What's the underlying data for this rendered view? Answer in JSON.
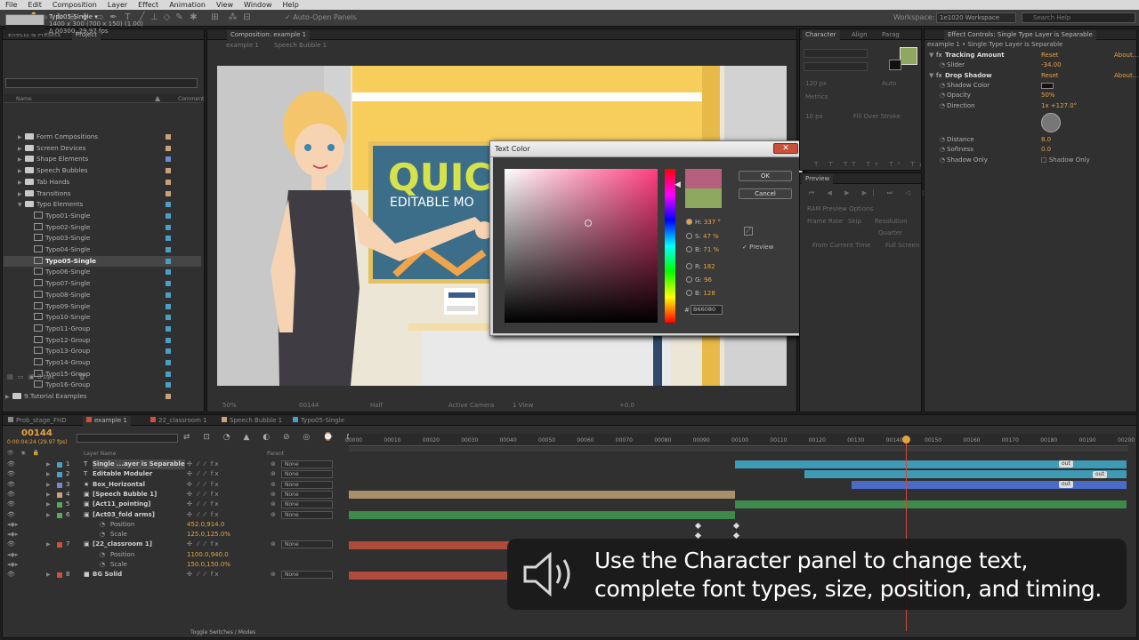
{
  "menu": [
    "File",
    "Edit",
    "Composition",
    "Layer",
    "Effect",
    "Animation",
    "View",
    "Window",
    "Help"
  ],
  "toolbar": {
    "auto_open": "Auto-Open Panels",
    "workspace_label": "Workspace:",
    "workspace_value": "1e1020 Workspace",
    "search_placeholder": "Search Help"
  },
  "project": {
    "tabs": [
      "Effects & Presets",
      "Project"
    ],
    "comp_name": "Typo05-Single ▾",
    "comp_size": "1400 x 300  (700 x 150) (1.00)",
    "comp_dur": "Δ 00300, 29.97 fps",
    "col_name": "Name",
    "col_comment": "Comment",
    "bpc": "8 bpc",
    "items": [
      {
        "label": "Form Compositions",
        "type": "folder",
        "color": "#c8a27a"
      },
      {
        "label": "Screen Devices",
        "type": "folder",
        "color": "#c8a27a"
      },
      {
        "label": "Shape Elements",
        "type": "folder",
        "color": "#6f8bd1"
      },
      {
        "label": "Speech Bubbles",
        "type": "folder",
        "color": "#c8a27a"
      },
      {
        "label": "Tab Hands",
        "type": "folder",
        "color": "#c8a27a"
      },
      {
        "label": "Transitions",
        "type": "folder",
        "color": "#c8a27a"
      },
      {
        "label": "Typo Elements",
        "type": "folder-open",
        "color": "#4aa0c4"
      },
      {
        "label": "Typo01-Single",
        "type": "comp",
        "color": "#4aa0c4"
      },
      {
        "label": "Typo02-Single",
        "type": "comp",
        "color": "#4aa0c4"
      },
      {
        "label": "Typo03-Single",
        "type": "comp",
        "color": "#4aa0c4"
      },
      {
        "label": "Typo04-Single",
        "type": "comp",
        "color": "#4aa0c4"
      },
      {
        "label": "Typo05-Single",
        "type": "comp",
        "color": "#4aa0c4",
        "selected": true
      },
      {
        "label": "Typo06-Single",
        "type": "comp",
        "color": "#4aa0c4"
      },
      {
        "label": "Typo07-Single",
        "type": "comp",
        "color": "#4aa0c4"
      },
      {
        "label": "Typo08-Single",
        "type": "comp",
        "color": "#4aa0c4"
      },
      {
        "label": "Typo09-Single",
        "type": "comp",
        "color": "#4aa0c4"
      },
      {
        "label": "Typo10-Single",
        "type": "comp",
        "color": "#4aa0c4"
      },
      {
        "label": "Typo11-Group",
        "type": "comp",
        "color": "#4aa0c4"
      },
      {
        "label": "Typo12-Group",
        "type": "comp",
        "color": "#4aa0c4"
      },
      {
        "label": "Typo13-Group",
        "type": "comp",
        "color": "#4aa0c4"
      },
      {
        "label": "Typo14-Group",
        "type": "comp",
        "color": "#4aa0c4"
      },
      {
        "label": "Typo15-Group",
        "type": "comp",
        "color": "#4aa0c4"
      },
      {
        "label": "Typo16-Group",
        "type": "comp",
        "color": "#4aa0c4"
      },
      {
        "label": "9.Tutorial Examples",
        "type": "folder",
        "color": "#c8a27a"
      }
    ]
  },
  "composition": {
    "tab": "Composition: example 1",
    "subtabs": [
      "example 1",
      "Speech Bubble 1"
    ],
    "canvas_text1": "QUIC",
    "canvas_text2": "EDITABLE MO",
    "footer": [
      "50%",
      "00144",
      "Half",
      "Active Camera",
      "1 View",
      "+0.0"
    ]
  },
  "dialog": {
    "title": "Text Color",
    "ok": "OK",
    "cancel": "Cancel",
    "new_color": "#b66080",
    "old_color": "#8fa860",
    "h_label": "H:",
    "h_val": "337 °",
    "s_label": "S:",
    "s_val": "47 %",
    "b_label": "B:",
    "b_val": "71 %",
    "r_label": "R:",
    "r_val": "182",
    "g_label": "G:",
    "g_val": "96",
    "bl_label": "B:",
    "bl_val": "128",
    "hex": "B66080",
    "preview": "Preview"
  },
  "character": {
    "tabs": [
      "Character",
      "Align",
      "Parag"
    ],
    "fill_over": "Fill Over Stroke",
    "metrics": "Metrics",
    "size": "120 px",
    "auto": "Auto",
    "stroke": "10 px"
  },
  "preview_panel": {
    "tabs": [
      "Preview"
    ],
    "ram_opt": "RAM Preview Options",
    "frame_rate": "Frame Rate",
    "skip": "Skip",
    "resolution": "Resolution",
    "from_current": "From Current Time",
    "full_screen": "Full Screen",
    "quarter": "Quarter"
  },
  "effects": {
    "tab": "Effect Controls: Single Type Layer is Separable",
    "header": "example 1 • Single Type Layer is Separable",
    "rows": [
      {
        "label": "Tracking Amount",
        "indent": 0,
        "bold": true,
        "fx": true,
        "link": "Reset",
        "link2": "About..."
      },
      {
        "label": "Slider",
        "indent": 1,
        "val": "-34.00"
      },
      {
        "label": "Drop Shadow",
        "indent": 0,
        "bold": true,
        "fx": true,
        "link": "Reset",
        "link2": "About..."
      },
      {
        "label": "Shadow Color",
        "indent": 1,
        "color": "#111111"
      },
      {
        "label": "Opacity",
        "indent": 1,
        "val": "50%"
      },
      {
        "label": "Direction",
        "indent": 1,
        "val": "1x +127.0°"
      },
      {
        "label": "Distance",
        "indent": 1,
        "val": "8.0"
      },
      {
        "label": "Softness",
        "indent": 1,
        "val": "0.0"
      },
      {
        "label": "Shadow Only",
        "indent": 1,
        "check": "Shadow Only"
      }
    ]
  },
  "timeline": {
    "tabs": [
      "Prob_stage_FHD",
      "example 1",
      "22_classroom 1",
      "Speech Bubble 1",
      "Typo05-Single"
    ],
    "time": "00144",
    "fps": "0:00:04:24 (29.97 fps)",
    "col_layer": "Layer Name",
    "col_parent": "Parent",
    "ticks": [
      "00000",
      "00010",
      "00020",
      "00030",
      "00040",
      "00050",
      "00060",
      "00070",
      "00080",
      "00090",
      "00100",
      "00110",
      "00120",
      "00130",
      "00140",
      "00150",
      "00160",
      "00170",
      "00180",
      "00190",
      "00200"
    ],
    "layers": [
      {
        "num": "1",
        "name": "Single ...ayer is Separable",
        "color": "#4aa0c4",
        "parent": "None",
        "kind": "T"
      },
      {
        "num": "2",
        "name": "Editable Moduler",
        "color": "#4aa0c4",
        "parent": "None",
        "kind": "T"
      },
      {
        "num": "3",
        "name": "Box_Horizontal",
        "color": "#6f8bd1",
        "parent": "None",
        "kind": "★"
      },
      {
        "num": "4",
        "name": "[Speech Bubble 1]",
        "color": "#c8a27a",
        "parent": "None",
        "kind": "▣"
      },
      {
        "num": "5",
        "name": "[Act11_pointing]",
        "color": "#5aaa55",
        "parent": "None",
        "kind": "▣"
      },
      {
        "num": "6",
        "name": "[Act03_fold arms]",
        "color": "#5aaa55",
        "parent": "None",
        "kind": "▣"
      },
      {
        "sub": "Position",
        "val": "452.0,914.0"
      },
      {
        "sub": "Scale",
        "val": "125.0,125.0%"
      },
      {
        "num": "7",
        "name": "[22_classroom 1]",
        "color": "#d0503a",
        "parent": "None",
        "kind": "▣"
      },
      {
        "sub": "Position",
        "val": "1100.0,940.0"
      },
      {
        "sub": "Scale",
        "val": "150.0,150.0%"
      },
      {
        "num": "8",
        "name": "BG Solid",
        "color": "#d0503a",
        "parent": "None",
        "kind": "■"
      }
    ],
    "out_label": "out",
    "toggle": "Toggle Switches / Modes"
  },
  "caption": {
    "line1": "Use the Character panel to change text,",
    "line2": "complete font types, size, position, and timing."
  }
}
